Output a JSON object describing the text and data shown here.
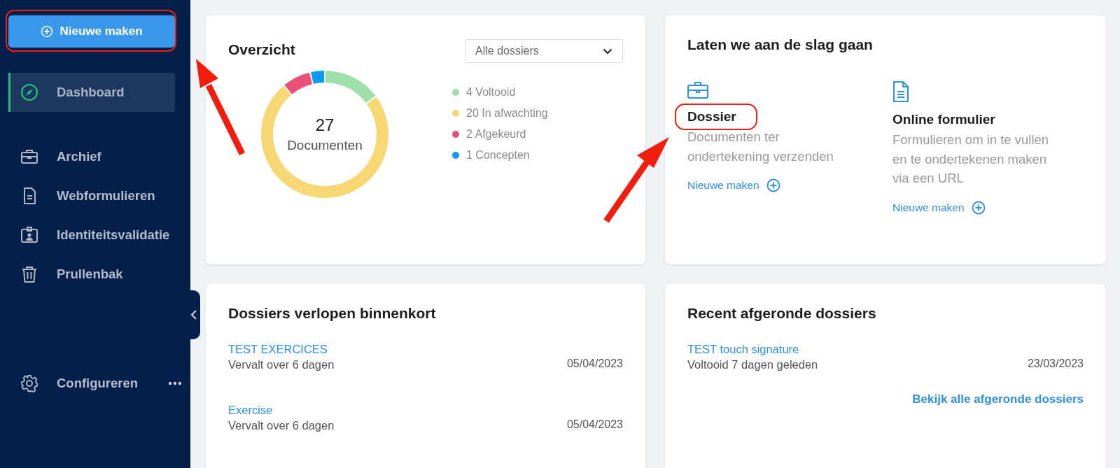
{
  "sidebar": {
    "new_button": "Nieuwe maken",
    "nav_items": [
      {
        "label": "Dashboard",
        "selected": true
      },
      {
        "label": "Archief",
        "selected": false
      },
      {
        "label": "Webformulieren",
        "selected": false
      },
      {
        "label": "Identiteitsvalidatie",
        "selected": false
      },
      {
        "label": "Prullenbak",
        "selected": false
      }
    ],
    "settings_item": "Configureren"
  },
  "overview": {
    "title": "Overzicht",
    "filter": "Alle dossiers",
    "total": "27",
    "total_label": "Documenten",
    "legend": [
      {
        "color": "#9ee0aa"
      },
      {
        "color": "#f7d774"
      },
      {
        "color": "#ea5077"
      },
      {
        "color": "#0b9af5"
      }
    ],
    "chart_data": {
      "type": "donut",
      "categories": [
        "4 Voltooid",
        "20 In afwachting",
        "2 Afgekeurd",
        "1 Concepten"
      ],
      "values": [
        4,
        20,
        2,
        1
      ]
    }
  },
  "get_started": {
    "title": "Laten we aan de slag gaan",
    "options": [
      {
        "title": "Dossier",
        "description": "Documenten ter ondertekening verzenden",
        "action": "Nieuwe maken"
      },
      {
        "title": "Online formulier",
        "description": "Formulieren om in te vullen en te ondertekenen maken via een URL",
        "action": "Nieuwe maken"
      }
    ]
  },
  "expiring": {
    "title": "Dossiers verlopen binnenkort",
    "items": [
      {
        "name": "TEST EXERCICES",
        "status": "Vervalt over 6 dagen",
        "date": "05/04/2023"
      },
      {
        "name": "Exercise",
        "status": "Vervalt over 6 dagen",
        "date": "05/04/2023"
      }
    ]
  },
  "completed": {
    "title": "Recent afgeronde dossiers",
    "items": [
      {
        "name": "TEST touch signature",
        "status": "Voltooid 7 dagen geleden",
        "date": "23/03/2023"
      }
    ],
    "view_all": "Bekijk alle afgeronde dossiers"
  }
}
